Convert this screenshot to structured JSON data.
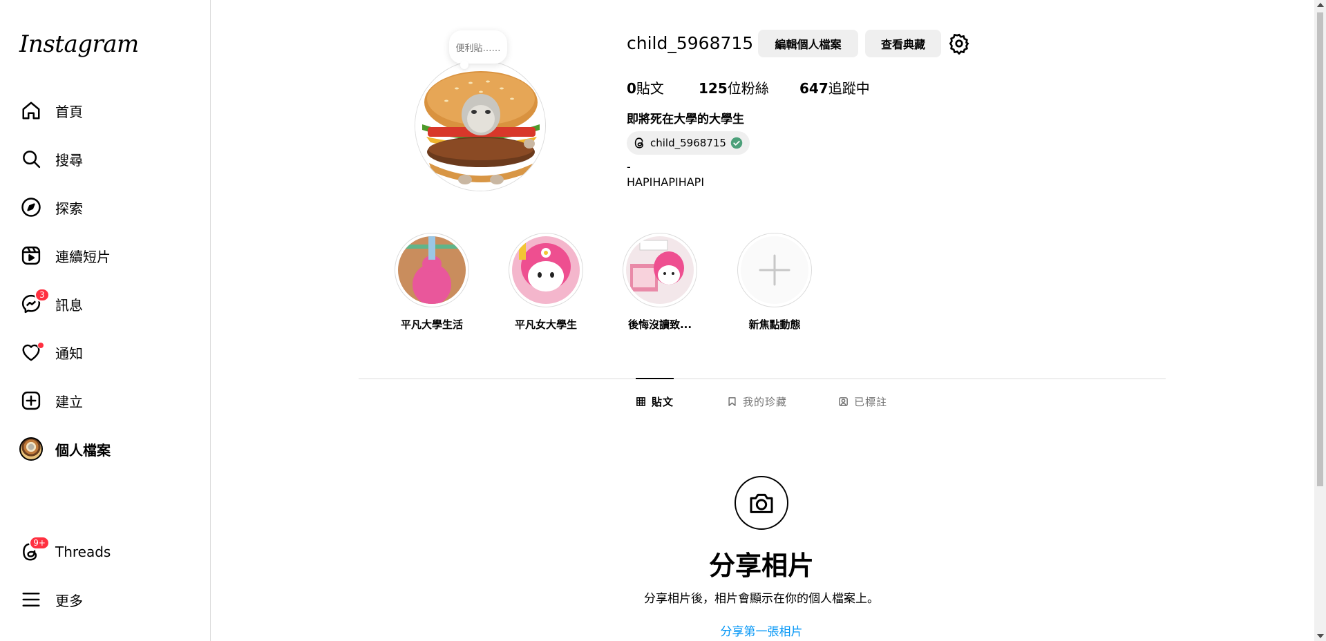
{
  "sidebar": {
    "logo": "Instagram",
    "items": [
      {
        "label": "首頁",
        "icon": "home-icon"
      },
      {
        "label": "搜尋",
        "icon": "search-icon"
      },
      {
        "label": "探索",
        "icon": "compass-icon"
      },
      {
        "label": "連續短片",
        "icon": "reels-icon"
      },
      {
        "label": "訊息",
        "icon": "messenger-icon",
        "badge": "3"
      },
      {
        "label": "通知",
        "icon": "heart-icon"
      },
      {
        "label": "建立",
        "icon": "plus-square-icon"
      },
      {
        "label": "個人檔案",
        "icon": "avatar"
      },
      {
        "label": "Threads",
        "icon": "threads-icon",
        "badge": "9+"
      },
      {
        "label": "更多",
        "icon": "menu-icon"
      }
    ]
  },
  "profile": {
    "note": "便利貼……",
    "username": "child_5968715",
    "edit_button": "編輯個人檔案",
    "archive_button": "查看典藏",
    "stats": {
      "posts_count": "0",
      "posts_label": "貼文",
      "followers_count": "125",
      "followers_label": "位粉絲",
      "following_count": "647",
      "following_label": "追蹤中"
    },
    "full_name": "即將死在大學的大學生",
    "threads_handle": "child_5968715",
    "bio_line1": "-",
    "bio_line2": "HAPIHAPIHAPI"
  },
  "highlights": [
    {
      "label": "平凡大學生活"
    },
    {
      "label": "平凡女大學生"
    },
    {
      "label": "後悔沒讀致..."
    },
    {
      "label": "新焦點動態"
    }
  ],
  "tabs": [
    {
      "label": "貼文",
      "icon": "grid-icon",
      "active": true
    },
    {
      "label": "我的珍藏",
      "icon": "bookmark-icon",
      "active": false
    },
    {
      "label": "已標註",
      "icon": "tagged-icon",
      "active": false
    }
  ],
  "empty_state": {
    "icon": "camera-icon",
    "title": "分享相片",
    "subtitle": "分享相片後，相片會顯示在你的個人檔案上。",
    "link": "分享第一張相片"
  },
  "colors": {
    "badge": "#ff3040",
    "link": "#0095f6",
    "button_bg": "#efefef",
    "verified": "#4ca07a"
  }
}
